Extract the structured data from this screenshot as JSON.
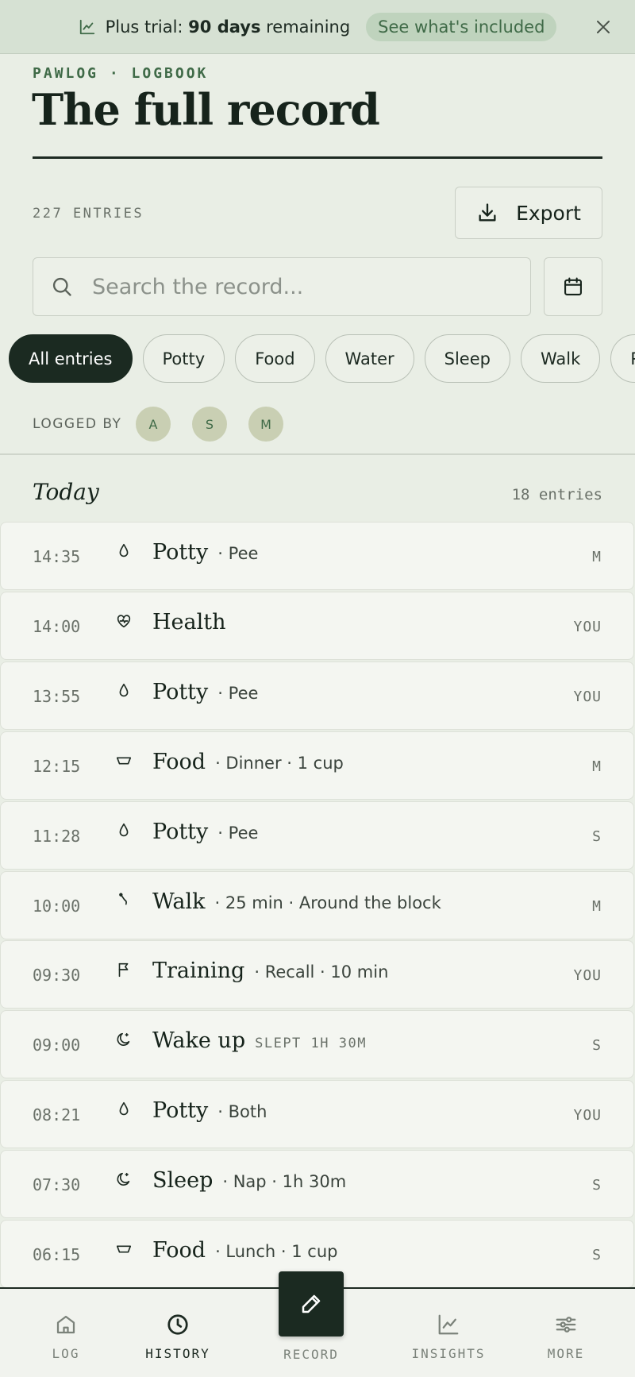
{
  "banner": {
    "prefix": "Plus trial: ",
    "days": "90 days",
    "suffix": " remaining",
    "cta": "See what's included"
  },
  "header": {
    "eyebrow": "PAWLOG · LOGBOOK",
    "title": "The full record"
  },
  "toolbar": {
    "entry_count": "227 ENTRIES",
    "export_label": "Export"
  },
  "search": {
    "placeholder": "Search the record..."
  },
  "filters": [
    "All entries",
    "Potty",
    "Food",
    "Water",
    "Sleep",
    "Walk",
    "Play"
  ],
  "active_filter": "All entries",
  "logged_by": {
    "label": "LOGGED BY",
    "people": [
      "A",
      "S",
      "M"
    ]
  },
  "day": {
    "label": "Today",
    "count": "18 entries"
  },
  "entries": [
    {
      "time": "14:35",
      "icon": "drop-icon",
      "category": "Potty",
      "detail": "· Pee",
      "note": "",
      "who": "M"
    },
    {
      "time": "14:00",
      "icon": "heart-icon",
      "category": "Health",
      "detail": "",
      "note": "",
      "who": "YOU"
    },
    {
      "time": "13:55",
      "icon": "drop-icon",
      "category": "Potty",
      "detail": "· Pee",
      "note": "",
      "who": "YOU"
    },
    {
      "time": "12:15",
      "icon": "bowl-icon",
      "category": "Food",
      "detail": "· Dinner · 1 cup",
      "note": "",
      "who": "M"
    },
    {
      "time": "11:28",
      "icon": "drop-icon",
      "category": "Potty",
      "detail": "· Pee",
      "note": "",
      "who": "S"
    },
    {
      "time": "10:00",
      "icon": "leash-icon",
      "category": "Walk",
      "detail": "· 25 min · Around the block",
      "note": "",
      "who": "M"
    },
    {
      "time": "09:30",
      "icon": "flag-icon",
      "category": "Training",
      "detail": "· Recall · 10 min",
      "note": "",
      "who": "YOU"
    },
    {
      "time": "09:00",
      "icon": "moon-icon",
      "category": "Wake up",
      "detail": "",
      "note": "SLEPT 1H 30M",
      "who": "S"
    },
    {
      "time": "08:21",
      "icon": "drop-icon",
      "category": "Potty",
      "detail": "· Both",
      "note": "",
      "who": "YOU"
    },
    {
      "time": "07:30",
      "icon": "moon-icon",
      "category": "Sleep",
      "detail": "· Nap · 1h 30m",
      "note": "",
      "who": "S"
    },
    {
      "time": "06:15",
      "icon": "bowl-icon",
      "category": "Food",
      "detail": "· Lunch · 1 cup",
      "note": "",
      "who": "S"
    }
  ],
  "nav": {
    "log": "LOG",
    "history": "HISTORY",
    "record": "RECORD",
    "insights": "INSIGHTS",
    "more": "MORE",
    "active": "history"
  },
  "colors": {
    "background": "#e9eee5",
    "banner": "#d6e1d3",
    "accent_green": "#3f6a47",
    "ink": "#1b2a21",
    "row": "#f4f6f1"
  }
}
